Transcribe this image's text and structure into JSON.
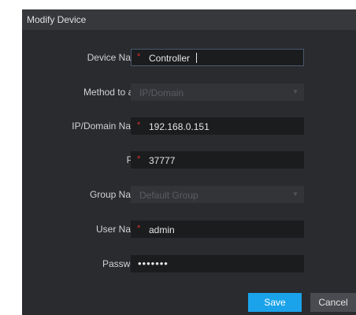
{
  "dialog": {
    "title": "Modify Device"
  },
  "form": {
    "device_name": {
      "label": "Device Name:",
      "required_mark": "*",
      "value": "Controller"
    },
    "method": {
      "label": "Method to add:",
      "value": "IP/Domain"
    },
    "ip": {
      "label": "IP/Domain Name:",
      "required_mark": "*",
      "value": "192.168.0.151"
    },
    "port": {
      "label": "Port:",
      "required_mark": "*",
      "value": "37777"
    },
    "group": {
      "label": "Group Name:",
      "value": "Default Group"
    },
    "user": {
      "label": "User Name:",
      "required_mark": "*",
      "value": "admin"
    },
    "password": {
      "label": "Password:",
      "value": "•••••••"
    }
  },
  "buttons": {
    "save": "Save",
    "cancel": "Cancel"
  },
  "colors": {
    "accent": "#1aa3ea",
    "required": "#d8322e",
    "dialog_bg": "#2a2b2f"
  }
}
